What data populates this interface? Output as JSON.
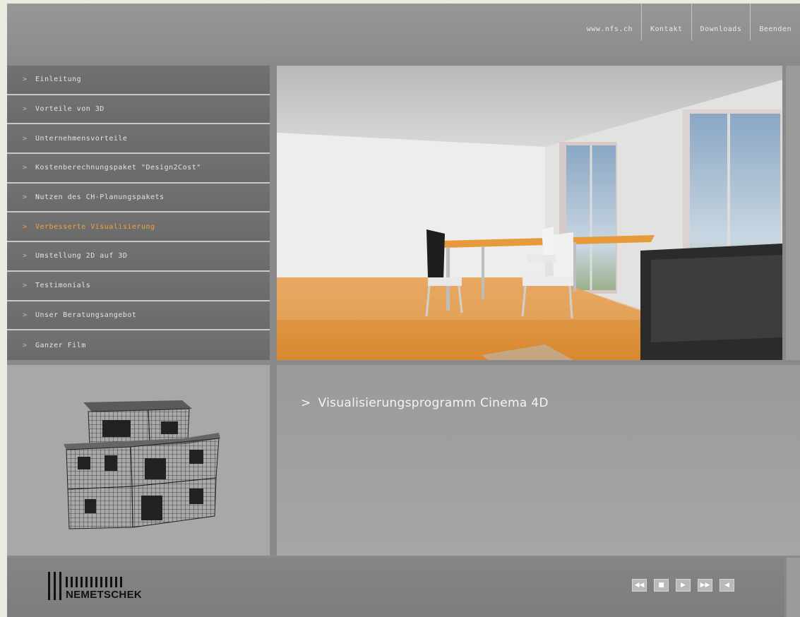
{
  "top_nav": [
    {
      "label": "www.nfs.ch"
    },
    {
      "label": "Kontakt"
    },
    {
      "label": "Downloads"
    },
    {
      "label": "Beenden"
    }
  ],
  "menu": [
    {
      "label": "Einleitung",
      "active": false
    },
    {
      "label": "Vorteile von 3D",
      "active": false
    },
    {
      "label": "Unternehmensvorteile",
      "active": false
    },
    {
      "label": "Kostenberechnungspaket \"Design2Cost\"",
      "active": false
    },
    {
      "label": "Nutzen des CH-Planungspakets",
      "active": false
    },
    {
      "label": "Verbesserte Visualisierung",
      "active": true
    },
    {
      "label": "Umstellung 2D auf 3D",
      "active": false
    },
    {
      "label": "Testimonials",
      "active": false
    },
    {
      "label": "Unser Beratungsangebot",
      "active": false
    },
    {
      "label": "Ganzer Film",
      "active": false
    }
  ],
  "info": {
    "chevron": ">",
    "title": "Visualisierungsprogramm Cinema 4D"
  },
  "logo": {
    "text": "NEMETSCHEK"
  },
  "controls": [
    {
      "name": "rewind-button",
      "icon": "rewind-icon",
      "glyph": "◀◀"
    },
    {
      "name": "stop-button",
      "icon": "stop-icon",
      "glyph": "■"
    },
    {
      "name": "play-button",
      "icon": "play-icon",
      "glyph": "▶"
    },
    {
      "name": "fast-forward-button",
      "icon": "fast-forward-icon",
      "glyph": "▶▶"
    },
    {
      "name": "volume-button",
      "icon": "speaker-icon",
      "glyph": "◀"
    }
  ],
  "colors": {
    "active_menu": "#f2a23a",
    "panel": "#8a8a8a"
  }
}
